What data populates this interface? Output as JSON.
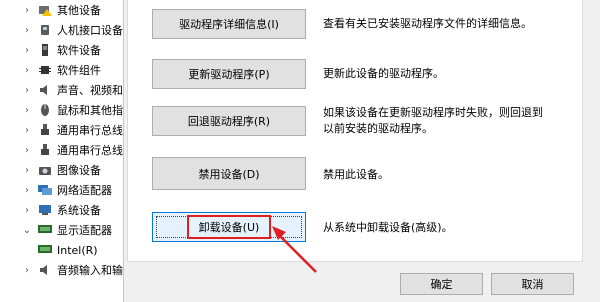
{
  "tree": {
    "items": [
      {
        "label": "其他设备",
        "expanded": false,
        "icon": "warning-device-icon"
      },
      {
        "label": "人机接口设备",
        "expanded": false,
        "icon": "hid-icon"
      },
      {
        "label": "软件设备",
        "expanded": false,
        "icon": "software-device-icon"
      },
      {
        "label": "软件组件",
        "expanded": false,
        "icon": "software-component-icon"
      },
      {
        "label": "声音、视频和",
        "expanded": false,
        "icon": "speaker-icon"
      },
      {
        "label": "鼠标和其他指",
        "expanded": false,
        "icon": "mouse-icon"
      },
      {
        "label": "通用串行总线",
        "expanded": false,
        "icon": "usb-icon"
      },
      {
        "label": "通用串行总线",
        "expanded": false,
        "icon": "usb-icon"
      },
      {
        "label": "图像设备",
        "expanded": false,
        "icon": "camera-icon"
      },
      {
        "label": "网络适配器",
        "expanded": false,
        "icon": "network-icon"
      },
      {
        "label": "系统设备",
        "expanded": false,
        "icon": "system-icon"
      },
      {
        "label": "显示适配器",
        "expanded": true,
        "icon": "display-icon"
      },
      {
        "label": "Intel(R)",
        "child": true,
        "icon": "display-icon"
      },
      {
        "label": "音频输入和输",
        "expanded": false,
        "icon": "audio-icon"
      }
    ]
  },
  "actions": {
    "driver_details": {
      "button": "驱动程序详细信息(I)",
      "desc": "查看有关已安装驱动程序文件的详细信息。"
    },
    "update_driver": {
      "button": "更新驱动程序(P)",
      "desc": "更新此设备的驱动程序。"
    },
    "rollback_driver": {
      "button": "回退驱动程序(R)",
      "desc_line1": "如果该设备在更新驱动程序时失败，则回退到",
      "desc_line2": "以前安装的驱动程序。"
    },
    "disable_device": {
      "button": "禁用设备(D)",
      "desc": "禁用此设备。"
    },
    "uninstall_device": {
      "button": "卸载设备(U)",
      "desc": "从系统中卸载设备(高级)。"
    }
  },
  "footer": {
    "ok": "确定",
    "cancel": "取消"
  },
  "colors": {
    "highlight": "#e02020",
    "accent": "#0078d7"
  }
}
